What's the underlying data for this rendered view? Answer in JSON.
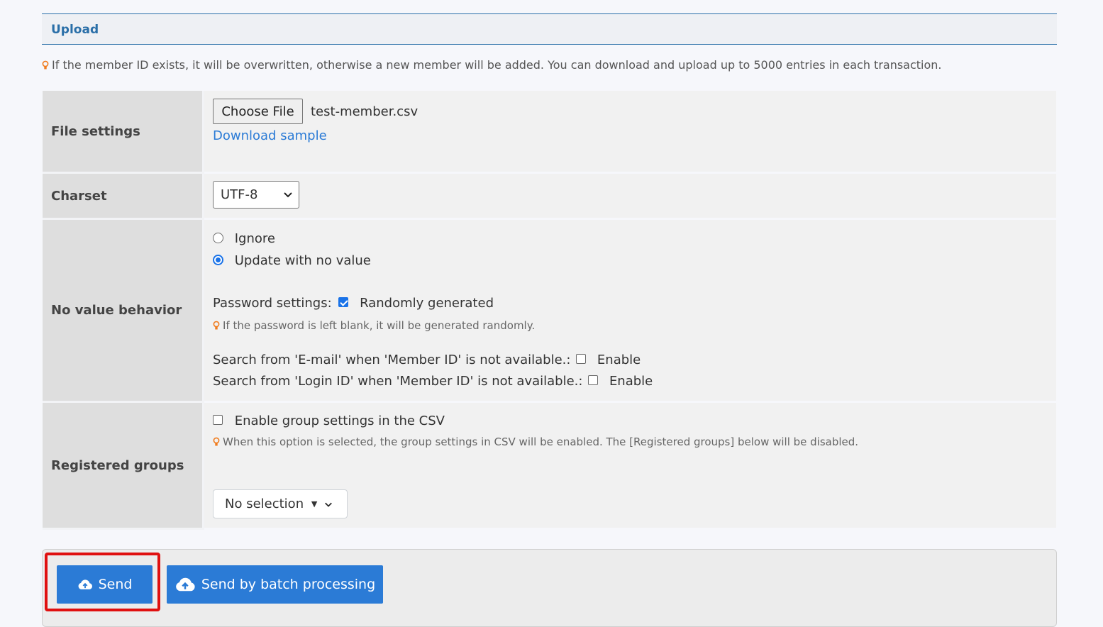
{
  "section": {
    "title": "Upload"
  },
  "top_note": "If the member ID exists, it will be overwritten, otherwise a new member will be added. You can download and upload up to 5000 entries in each transaction.",
  "file_settings": {
    "label": "File settings",
    "choose_button": "Choose File",
    "file_name": "test-member.csv",
    "download_link": "Download sample"
  },
  "charset": {
    "label": "Charset",
    "selected": "UTF-8"
  },
  "no_value": {
    "label": "No value behavior",
    "options": [
      {
        "label": "Ignore",
        "checked": false
      },
      {
        "label": "Update with no value",
        "checked": true
      }
    ],
    "password_label": "Password settings:",
    "password_option": "Randomly generated",
    "password_checked": true,
    "password_note": "If the password is left blank, it will be generated randomly.",
    "email_search_label": "Search from 'E-mail' when 'Member ID' is not available.:",
    "email_search_option": "Enable",
    "loginid_search_label": "Search from 'Login ID' when 'Member ID' is not available.:",
    "loginid_search_option": "Enable"
  },
  "groups": {
    "label": "Registered groups",
    "csv_option": "Enable group settings in the CSV",
    "csv_note": "When this option is selected, the group settings in CSV will be enabled. The [Registered groups] below will be disabled.",
    "selector": "No selection"
  },
  "footer": {
    "send": "Send",
    "send_batch": "Send by batch processing"
  },
  "colors": {
    "accent": "#2b7bd6",
    "highlight": "#e01010",
    "section_title": "#2a6fa8"
  }
}
